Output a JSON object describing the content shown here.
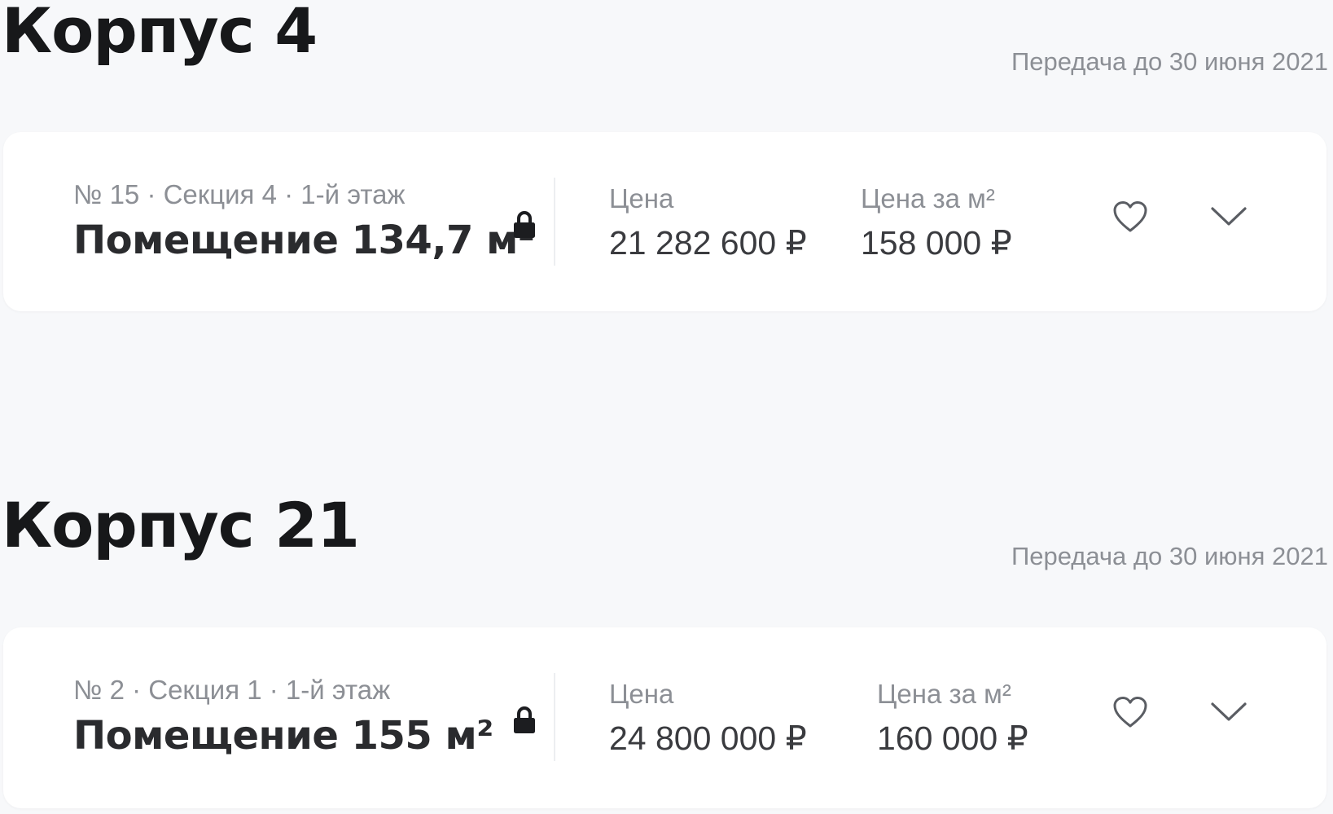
{
  "sections": [
    {
      "title": "Корпус 4",
      "delivery": "Передача до 30 июня 2021",
      "unit": {
        "meta": "№ 15 · Секция 4 · 1-й этаж",
        "title": "Помещение 134,7 м²",
        "price_label": "Цена",
        "price_value": "21 282 600 ₽",
        "sqm_price_label": "Цена за м²",
        "sqm_price_value": "158 000 ₽",
        "locked": true
      }
    },
    {
      "title": "Корпус 21",
      "delivery": "Передача до 30 июня 2021",
      "unit": {
        "meta": "№ 2 · Секция 1 · 1-й этаж",
        "title": "Помещение 155 м²",
        "price_label": "Цена",
        "price_value": "24 800 000 ₽",
        "sqm_price_label": "Цена за м²",
        "sqm_price_value": "160 000 ₽",
        "locked": true
      }
    }
  ],
  "icons": {
    "lock": "lock-icon",
    "favorite": "heart-icon",
    "expand": "chevron-down-icon"
  },
  "colors": {
    "background": "#f7f8fa",
    "card": "#ffffff",
    "heading": "#17181a",
    "muted_text": "#8c8f95",
    "icon_stroke": "#5a5d63"
  }
}
